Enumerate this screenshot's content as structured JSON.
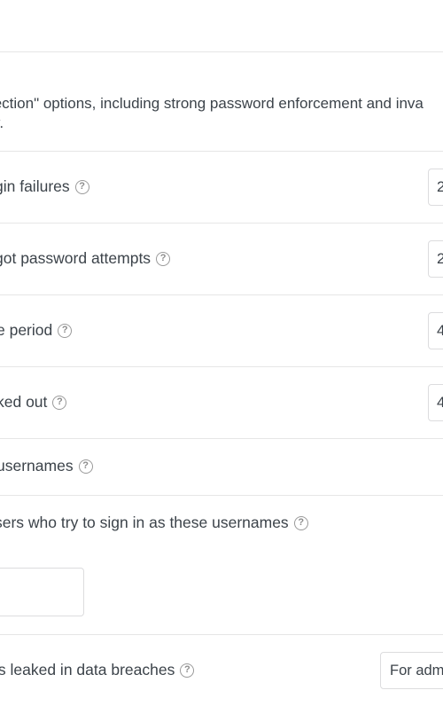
{
  "intro": {
    "line1": "tection\" options, including strong password enforcement and inva",
    "line2": "w."
  },
  "settings": {
    "login_failures": {
      "label": "gin failures",
      "value": "2"
    },
    "forgot_password": {
      "label": "got password attempts",
      "value": "2"
    },
    "time_period": {
      "label": "e period",
      "value": "4"
    },
    "locked_out": {
      "label": "ked out",
      "value": "4"
    },
    "usernames": {
      "label": "usernames"
    },
    "block_usernames": {
      "label": "sers who try to sign in as these usernames",
      "value": ""
    },
    "leaked_passwords": {
      "label": "ls leaked in data breaches",
      "value": "For admi"
    }
  },
  "icons": {
    "help": "?"
  }
}
